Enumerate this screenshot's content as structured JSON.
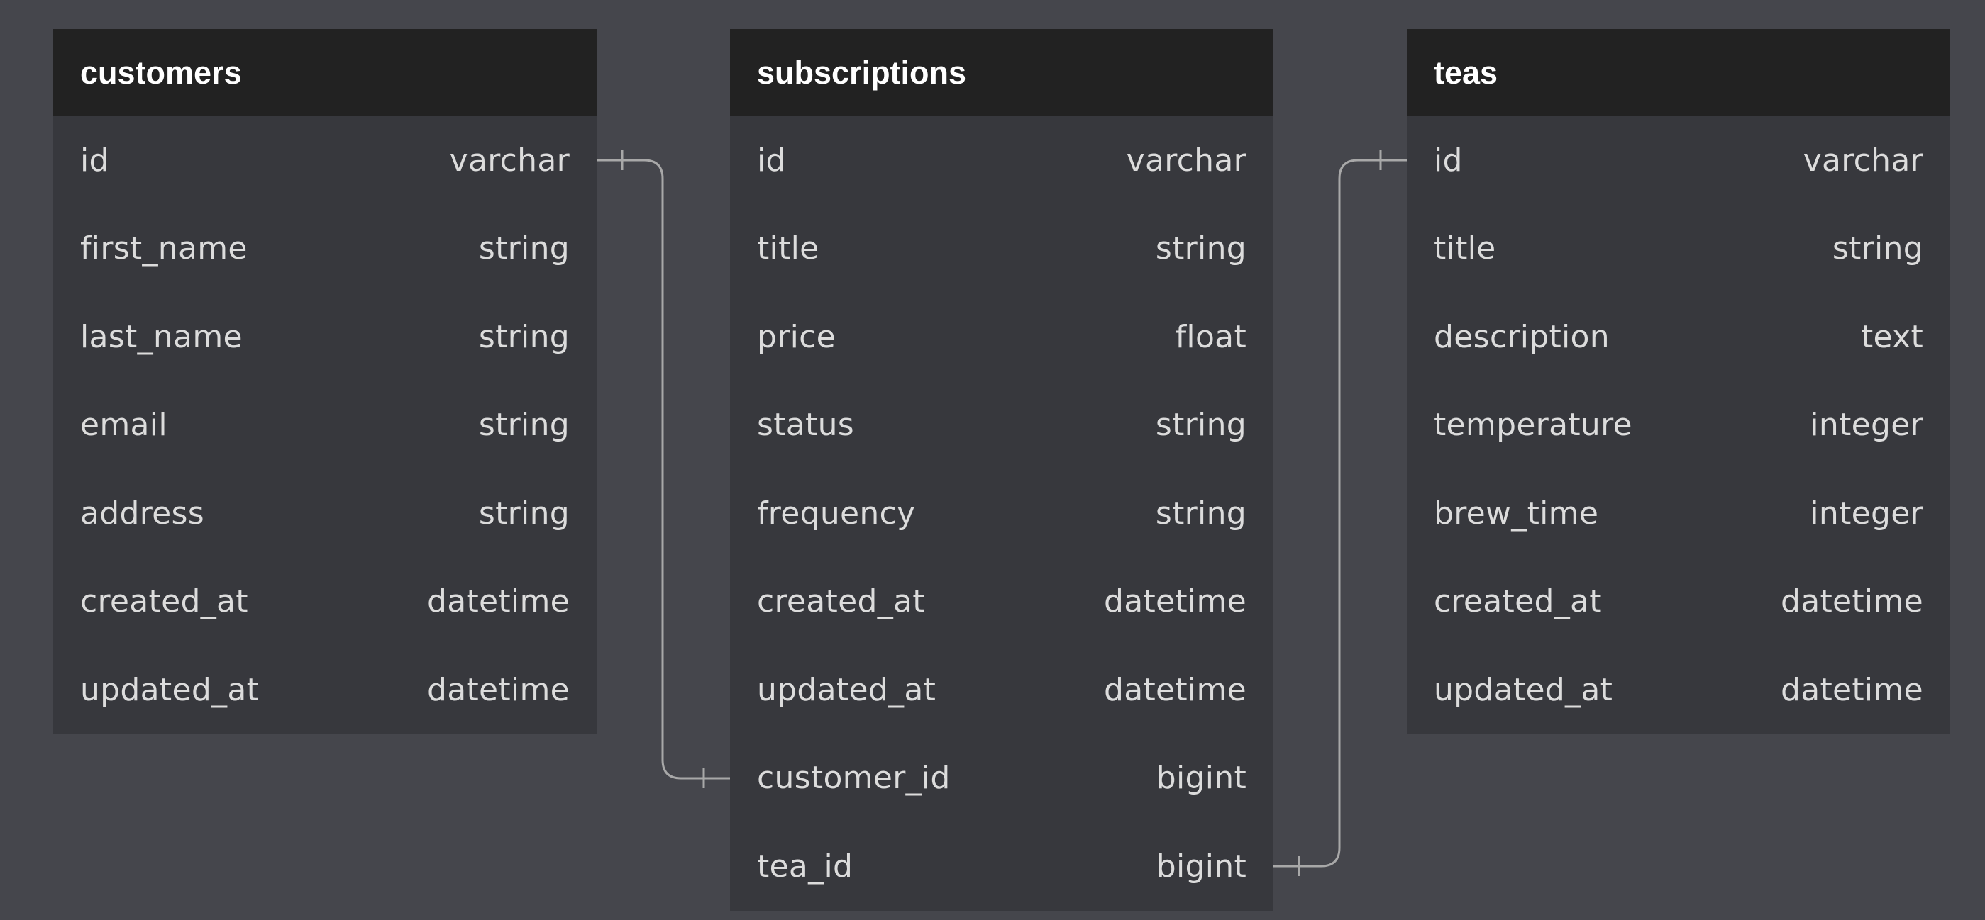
{
  "tables": [
    {
      "name": "customers",
      "fields": [
        {
          "name": "id",
          "type": "varchar"
        },
        {
          "name": "first_name",
          "type": "string"
        },
        {
          "name": "last_name",
          "type": "string"
        },
        {
          "name": "email",
          "type": "string"
        },
        {
          "name": "address",
          "type": "string"
        },
        {
          "name": "created_at",
          "type": "datetime"
        },
        {
          "name": "updated_at",
          "type": "datetime"
        }
      ]
    },
    {
      "name": "subscriptions",
      "fields": [
        {
          "name": "id",
          "type": "varchar"
        },
        {
          "name": "title",
          "type": "string"
        },
        {
          "name": "price",
          "type": "float"
        },
        {
          "name": "status",
          "type": "string"
        },
        {
          "name": "frequency",
          "type": "string"
        },
        {
          "name": "created_at",
          "type": "datetime"
        },
        {
          "name": "updated_at",
          "type": "datetime"
        },
        {
          "name": "customer_id",
          "type": "bigint"
        },
        {
          "name": "tea_id",
          "type": "bigint"
        }
      ]
    },
    {
      "name": "teas",
      "fields": [
        {
          "name": "id",
          "type": "varchar"
        },
        {
          "name": "title",
          "type": "string"
        },
        {
          "name": "description",
          "type": "text"
        },
        {
          "name": "temperature",
          "type": "integer"
        },
        {
          "name": "brew_time",
          "type": "integer"
        },
        {
          "name": "created_at",
          "type": "datetime"
        },
        {
          "name": "updated_at",
          "type": "datetime"
        }
      ]
    }
  ],
  "relationships": [
    {
      "from_table": "customers",
      "from_field": "id",
      "to_table": "subscriptions",
      "to_field": "customer_id",
      "cardinality": "one-to-one"
    },
    {
      "from_table": "subscriptions",
      "from_field": "tea_id",
      "to_table": "teas",
      "to_field": "id",
      "cardinality": "one-to-one"
    }
  ],
  "colors": {
    "canvas_background": "#45464c",
    "table_body": "#37383d",
    "table_header": "#222222",
    "header_text": "#ffffff",
    "field_text": "#dcdcdc",
    "connector_line": "#a8a8a8"
  }
}
